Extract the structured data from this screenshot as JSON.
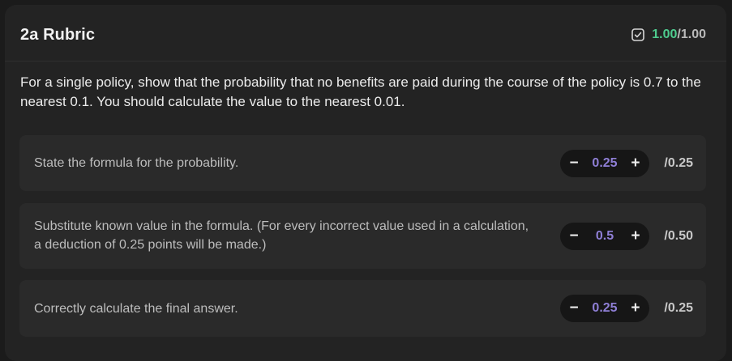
{
  "rubric": {
    "title": "2a Rubric",
    "score_earned": "1.00",
    "score_total": "/1.00",
    "icons": {
      "summary": "checkbox-checked-icon"
    },
    "colors": {
      "earned": "#4ecb8e",
      "stepper_value": "#8f7fd6"
    },
    "description": "For a single policy, show that the probability that no benefits are paid during the course of the policy is 0.7 to the nearest 0.1. You should calculate the value to the nearest 0.01."
  },
  "criteria": [
    {
      "text": "State the formula for the probability.",
      "decrement_label": "−",
      "value": "0.25",
      "increment_label": "+",
      "max": "/0.25"
    },
    {
      "text": "Substitute known value in the formula. (For every incorrect value used in a calculation, a deduction of 0.25 points will be made.)",
      "decrement_label": "−",
      "value": "0.5",
      "increment_label": "+",
      "max": "/0.50"
    },
    {
      "text": "Correctly calculate the final answer.",
      "decrement_label": "−",
      "value": "0.25",
      "increment_label": "+",
      "max": "/0.25"
    }
  ]
}
